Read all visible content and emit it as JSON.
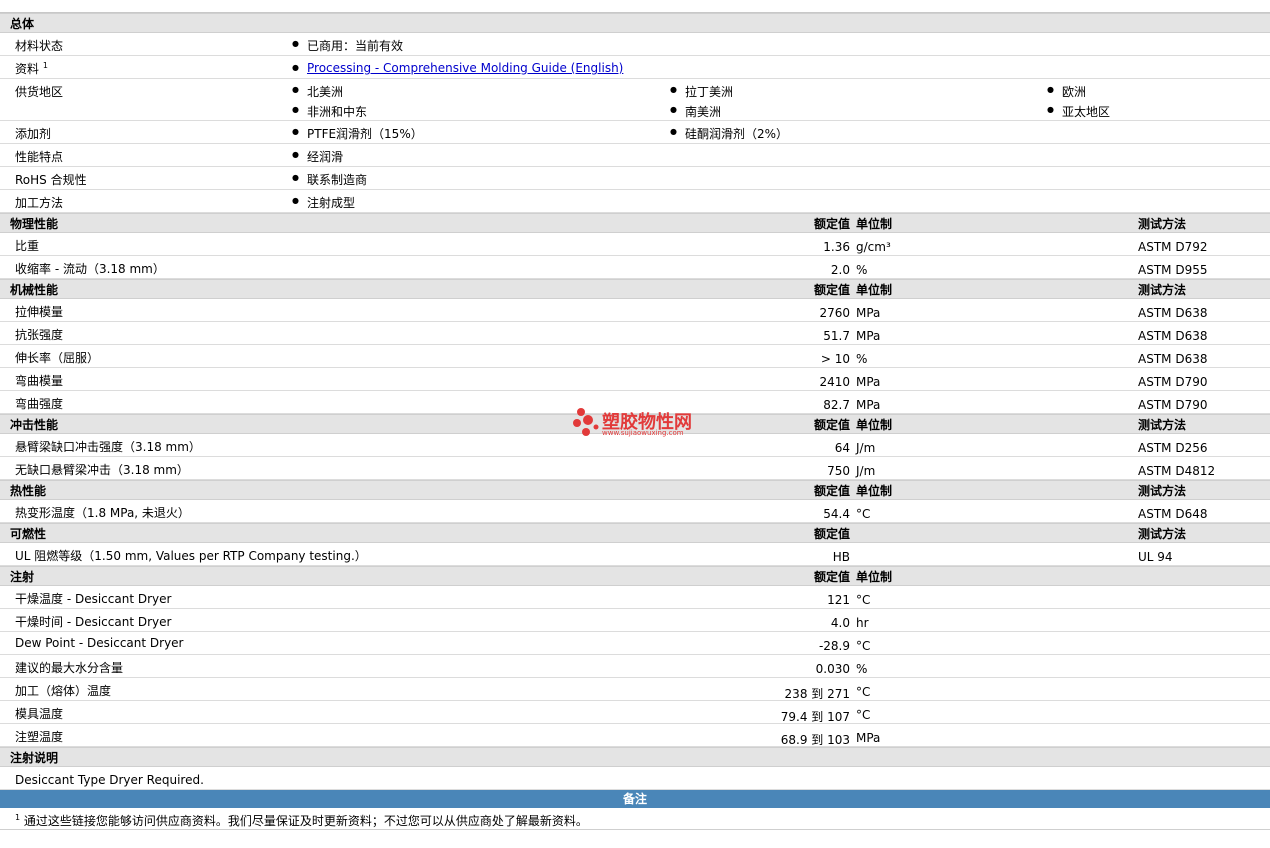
{
  "general": {
    "title": "总体",
    "rows": [
      {
        "label": "材料状态",
        "items": [
          "已商用：当前有效"
        ]
      },
      {
        "label": "资料",
        "footnote": "1",
        "link": "Processing - Comprehensive Molding Guide (English)"
      },
      {
        "label": "供货地区",
        "items": [
          "北美洲",
          "拉丁美洲",
          "欧洲",
          "非洲和中东",
          "南美洲",
          "亚太地区"
        ]
      },
      {
        "label": "添加剂",
        "items": [
          "PTFE润滑剂（15%）",
          "硅酮润滑剂（2%）"
        ]
      },
      {
        "label": "性能特点",
        "items": [
          "经润滑"
        ]
      },
      {
        "label": "RoHS 合规性",
        "items": [
          "联系制造商"
        ]
      },
      {
        "label": "加工方法",
        "items": [
          "注射成型"
        ]
      }
    ]
  },
  "headers": {
    "nominal": "额定值",
    "unit": "单位制",
    "test": "测试方法"
  },
  "sections": [
    {
      "title": "物理性能",
      "show_unit": true,
      "show_test": true,
      "rows": [
        {
          "label": "比重",
          "value": "1.36",
          "unit": "g/cm³",
          "test": "ASTM D792"
        },
        {
          "label": "收缩率 - 流动（3.18 mm）",
          "value": "2.0",
          "unit": "%",
          "test": "ASTM D955"
        }
      ]
    },
    {
      "title": "机械性能",
      "show_unit": true,
      "show_test": true,
      "rows": [
        {
          "label": "拉伸模量",
          "value": "2760",
          "unit": "MPa",
          "test": "ASTM D638"
        },
        {
          "label": "抗张强度",
          "value": "51.7",
          "unit": "MPa",
          "test": "ASTM D638"
        },
        {
          "label": "伸长率（屈服）",
          "value": "> 10",
          "unit": "%",
          "test": "ASTM D638"
        },
        {
          "label": "弯曲模量",
          "value": "2410",
          "unit": "MPa",
          "test": "ASTM D790"
        },
        {
          "label": "弯曲强度",
          "value": "82.7",
          "unit": "MPa",
          "test": "ASTM D790"
        }
      ]
    },
    {
      "title": "冲击性能",
      "show_unit": true,
      "show_test": true,
      "rows": [
        {
          "label": "悬臂梁缺口冲击强度（3.18 mm）",
          "value": "64",
          "unit": "J/m",
          "test": "ASTM D256"
        },
        {
          "label": "无缺口悬臂梁冲击（3.18 mm）",
          "value": "750",
          "unit": "J/m",
          "test": "ASTM D4812"
        }
      ]
    },
    {
      "title": "热性能",
      "show_unit": true,
      "show_test": true,
      "rows": [
        {
          "label": "热变形温度（1.8 MPa, 未退火）",
          "value": "54.4",
          "unit": "°C",
          "test": "ASTM D648"
        }
      ]
    },
    {
      "title": "可燃性",
      "show_unit": false,
      "show_test": true,
      "rows": [
        {
          "label": "UL 阻燃等级（1.50 mm, Values per RTP Company testing.）",
          "value": "HB",
          "unit": "",
          "test": "UL 94"
        }
      ]
    },
    {
      "title": "注射",
      "show_unit": true,
      "show_test": false,
      "rows": [
        {
          "label": "干燥温度 - Desiccant Dryer",
          "value": "121",
          "unit": "°C",
          "test": ""
        },
        {
          "label": "干燥时间 - Desiccant Dryer",
          "value": "4.0",
          "unit": "hr",
          "test": ""
        },
        {
          "label": "Dew Point - Desiccant Dryer",
          "value": "-28.9",
          "unit": "°C",
          "test": ""
        },
        {
          "label": "建议的最大水分含量",
          "value": "0.030",
          "unit": "%",
          "test": ""
        },
        {
          "label": "加工（熔体）温度",
          "value": "238 到 271",
          "unit": "°C",
          "test": ""
        },
        {
          "label": "模具温度",
          "value": "79.4 到 107",
          "unit": "°C",
          "test": ""
        },
        {
          "label": "注塑温度",
          "value": "68.9 到 103",
          "unit": "MPa",
          "test": ""
        }
      ]
    }
  ],
  "injection_notes": {
    "title": "注射说明",
    "text": "Desiccant Type Dryer Required."
  },
  "notes": {
    "title": "备注",
    "footnote_mark": "1",
    "text": "通过这些链接您能够访问供应商资料。我们尽量保证及时更新资料；不过您可以从供应商处了解最新资料。"
  },
  "watermark": {
    "brand": "塑胶物性网",
    "url": "www.sujiaowuxing.com"
  },
  "colors": {
    "section_bg": "#e4e4e4",
    "notes_bar": "#4a86b8",
    "link": "#0000cc",
    "watermark": "#e23a3a"
  }
}
